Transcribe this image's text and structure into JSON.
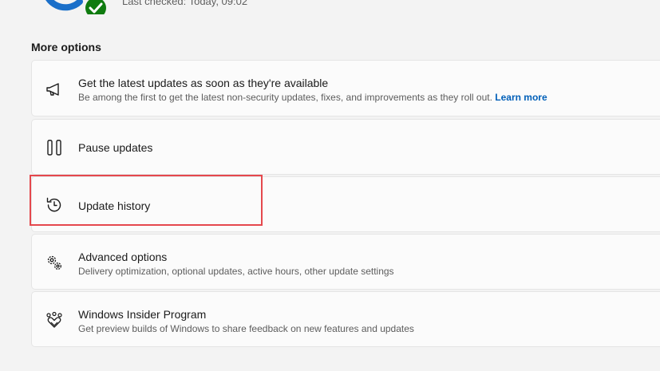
{
  "status": {
    "last_checked": "Last checked: Today, 09:02"
  },
  "more_options": {
    "title": "More options",
    "items": [
      {
        "title": "Get the latest updates as soon as they're available",
        "description": "Be among the first to get the latest non-security updates, fixes, and improvements as they roll out.",
        "link": "Learn more",
        "icon": "megaphone-icon"
      },
      {
        "title": "Pause updates",
        "icon": "pause-icon"
      },
      {
        "title": "Update history",
        "icon": "history-icon"
      },
      {
        "title": "Advanced options",
        "description": "Delivery optimization, optional updates, active hours, other update settings",
        "icon": "gears-icon"
      },
      {
        "title": "Windows Insider Program",
        "description": "Get preview builds of Windows to share feedback on new features and updates",
        "icon": "insider-hearts-icon"
      }
    ]
  },
  "colors": {
    "accent": "#005fb8",
    "success": "#0f7b0f",
    "update_ring": "#1a6fc9",
    "highlight": "#e5484d"
  }
}
